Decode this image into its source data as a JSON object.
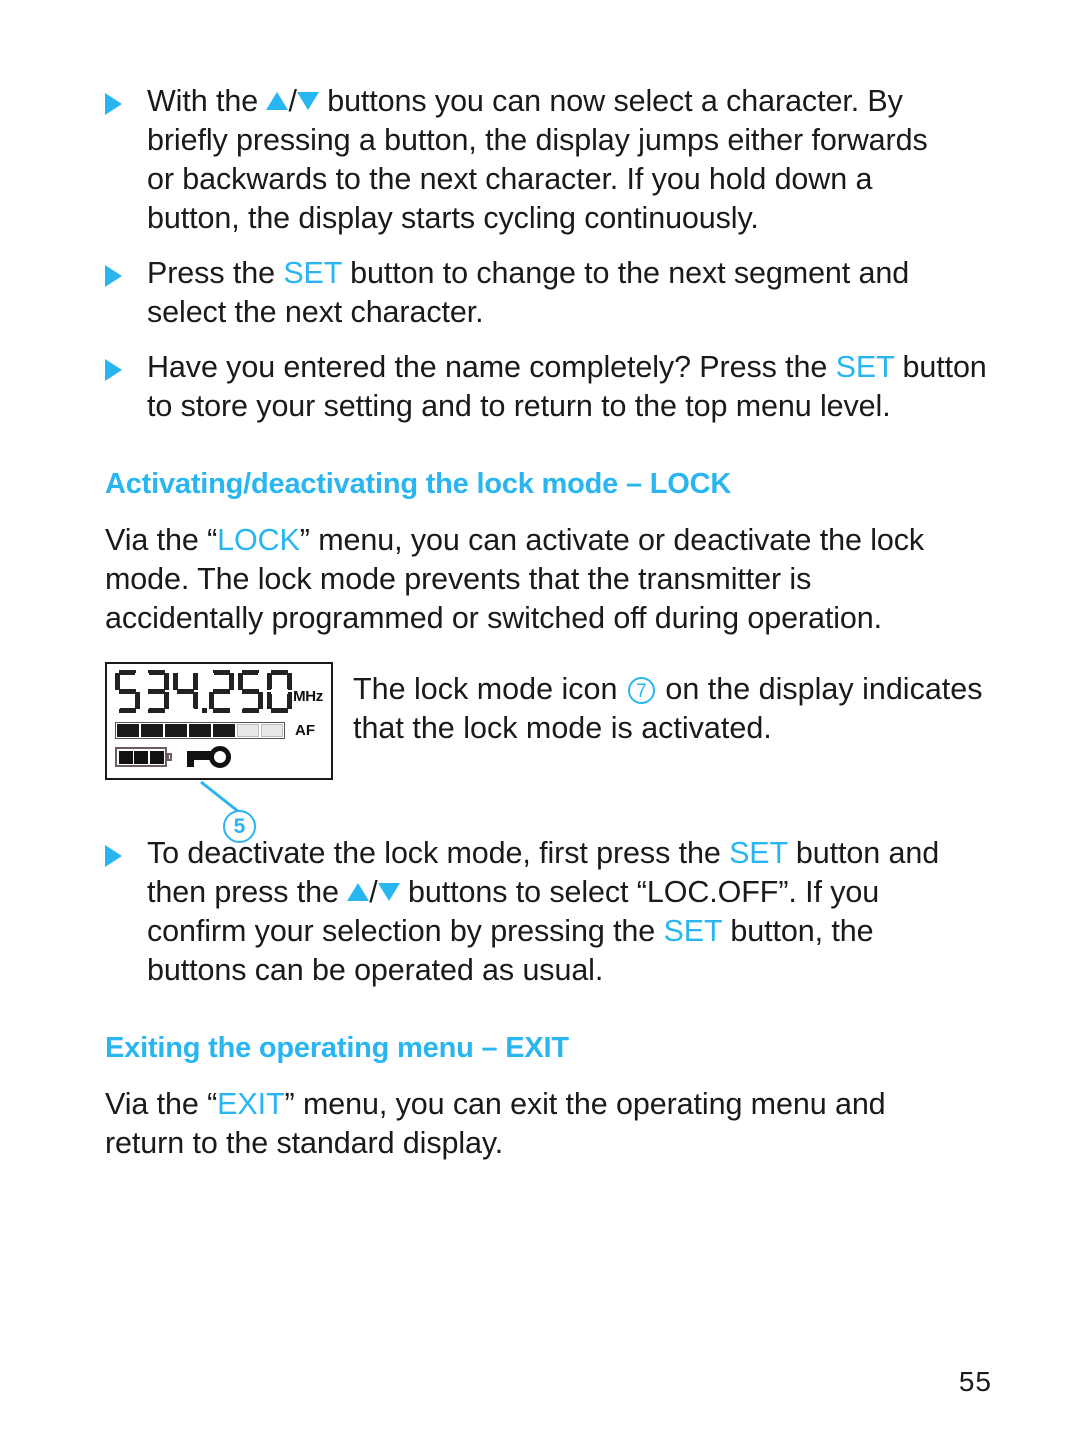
{
  "page": {
    "number": "55",
    "accent_color": "#29b6f0",
    "text_color": "#1a1a1a",
    "background": "#ffffff"
  },
  "bullets": [
    {
      "id": "select-character",
      "lines": [
        "With the ",
        " buttons you can now select a character. By",
        "briefly pressing a button, the display jumps either forwards",
        "or backwards to the next character. If you hold down a",
        "button, the display starts cycling continuously."
      ],
      "line1_pre": "With the ",
      "line1_post": " buttons you can now select a character. By",
      "line2": "briefly pressing a button, the display jumps either forwards",
      "line3": "or backwards to the next character. If you hold down a",
      "line4": "button, the display starts cycling continuously."
    },
    {
      "id": "next-segment",
      "line1_pre": "Press the ",
      "accent": "SET",
      "line1_post": " button to change to the next segment and",
      "line2": "select the next character."
    },
    {
      "id": "store-setting",
      "line1_pre": "Have you entered the name completely? Press the ",
      "accent": "SET",
      "line1_post": " button",
      "line2": "to store your setting and to return to the top menu level."
    },
    {
      "id": "deactivate-lock",
      "line1_pre": "To deactivate the lock mode, first press the ",
      "accent1": "SET",
      "line1_post": " button and",
      "line2_pre": "then press the ",
      "line2_post": " buttons to select “LOC.OFF”. If you",
      "line3_pre": "confirm your selection by pressing the ",
      "accent2": "SET",
      "line3_post": " button, the",
      "line4": "buttons can be operated as usual."
    }
  ],
  "sections": [
    {
      "id": "lock-mode",
      "heading": "Activating/deactivating the lock mode – LOCK",
      "body_line1_pre": "Via the “",
      "body_accent": "LOCK",
      "body_line1_post": "” menu, you can activate or deactivate the lock",
      "body_line2": "mode. The lock mode prevents that the transmitter is",
      "body_line3": "accidentally programmed or switched off during operation."
    },
    {
      "id": "exit-menu",
      "heading": "Exiting the operating menu – EXIT",
      "body_line1_pre": "Via the “",
      "body_accent": "EXIT",
      "body_line1_post": "” menu, you can exit the operating menu and",
      "body_line2": "return to the standard display."
    }
  ],
  "figure": {
    "caption_line1_pre": "The lock mode icon ",
    "caption_ref": "7",
    "caption_line1_post": " on the display indicates",
    "caption_line2": "that the lock mode is activated.",
    "callout_number": "5",
    "lcd": {
      "mhz_label": "MHz",
      "af_label": "AF",
      "af_cells_total": 7,
      "af_cells_filled": 5,
      "battery_cells_total": 3,
      "battery_cells_filled": 3,
      "digits": [
        "5",
        "3",
        "4",
        "2",
        "5",
        "0"
      ],
      "decimal_after_index": 2,
      "key_icon": "key-lock-icon"
    }
  }
}
